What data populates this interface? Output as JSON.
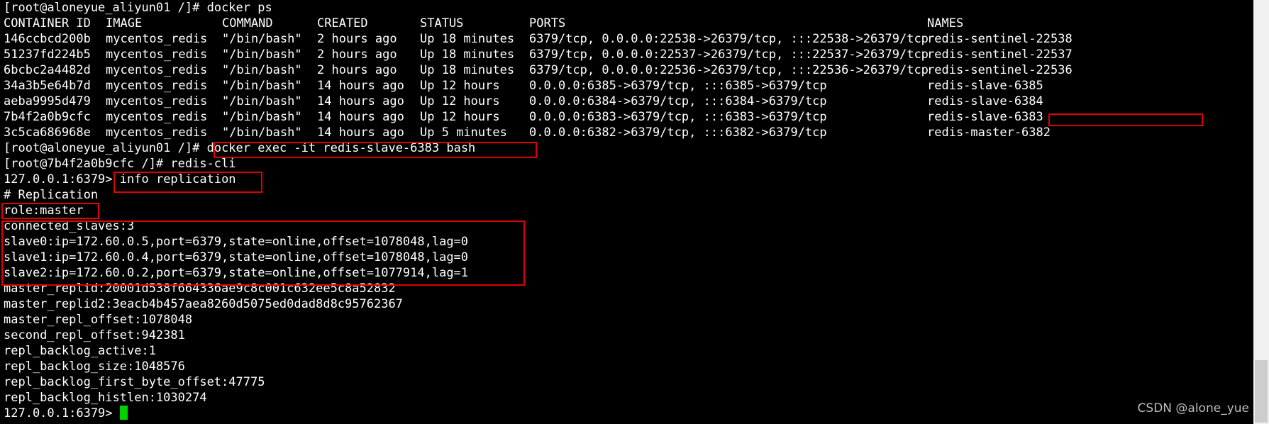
{
  "prompt_host": "[root@aloneyue_aliyun01 /]#",
  "cmd_ps": "docker ps",
  "table": {
    "headers": [
      "CONTAINER ID",
      "IMAGE",
      "COMMAND",
      "CREATED",
      "STATUS",
      "PORTS",
      "NAMES"
    ],
    "rows": [
      [
        "146ccbcd200b",
        "mycentos_redis",
        "\"/bin/bash\"",
        "2 hours ago",
        "Up 18 minutes",
        "6379/tcp, 0.0.0.0:22538->26379/tcp, :::22538->26379/tcp",
        "redis-sentinel-22538"
      ],
      [
        "51237fd224b5",
        "mycentos_redis",
        "\"/bin/bash\"",
        "2 hours ago",
        "Up 18 minutes",
        "6379/tcp, 0.0.0.0:22537->26379/tcp, :::22537->26379/tcp",
        "redis-sentinel-22537"
      ],
      [
        "6bcbc2a4482d",
        "mycentos_redis",
        "\"/bin/bash\"",
        "2 hours ago",
        "Up 18 minutes",
        "6379/tcp, 0.0.0.0:22536->26379/tcp, :::22536->26379/tcp",
        "redis-sentinel-22536"
      ],
      [
        "34a3b5e64b7d",
        "mycentos_redis",
        "\"/bin/bash\"",
        "14 hours ago",
        "Up 12 hours",
        "0.0.0.0:6385->6379/tcp, :::6385->6379/tcp",
        "redis-slave-6385"
      ],
      [
        "aeba9995d479",
        "mycentos_redis",
        "\"/bin/bash\"",
        "14 hours ago",
        "Up 12 hours",
        "0.0.0.0:6384->6379/tcp, :::6384->6379/tcp",
        "redis-slave-6384"
      ],
      [
        "7b4f2a0b9cfc",
        "mycentos_redis",
        "\"/bin/bash\"",
        "14 hours ago",
        "Up 12 hours",
        "0.0.0.0:6383->6379/tcp, :::6383->6379/tcp",
        "redis-slave-6383"
      ],
      [
        "3c5ca686968e",
        "mycentos_redis",
        "\"/bin/bash\"",
        "14 hours ago",
        "Up 5 minutes",
        "0.0.0.0:6382->6379/tcp, :::6382->6379/tcp",
        "redis-master-6382"
      ]
    ]
  },
  "cmd_exec": "docker exec -it redis-slave-6383 bash",
  "container_line": "[root@7b4f2a0b9cfc /]# redis-cli",
  "cli_prompt": "127.0.0.1:6379>",
  "cmd_info": "info replication",
  "output": {
    "heading": "# Replication",
    "role": "role:master",
    "slaves_block": [
      "connected_slaves:3",
      "slave0:ip=172.60.0.5,port=6379,state=online,offset=1078048,lag=0",
      "slave1:ip=172.60.0.4,port=6379,state=online,offset=1078048,lag=0",
      "slave2:ip=172.60.0.2,port=6379,state=online,offset=1077914,lag=1"
    ],
    "rest": [
      "master_replid:20001d538f664336ae9c8c001c632ee5c8a52832",
      "master_replid2:3eacb4b457aea8260d5075ed0dad8d8c95762367",
      "master_repl_offset:1078048",
      "second_repl_offset:942381",
      "repl_backlog_active:1",
      "repl_backlog_size:1048576",
      "repl_backlog_first_byte_offset:47775",
      "repl_backlog_histlen:1030274"
    ]
  },
  "watermark": "CSDN @alone_yue",
  "colors": {
    "background": "#000000",
    "text": "#ffffff",
    "highlight": "#e00000",
    "cursor": "#00d100"
  }
}
